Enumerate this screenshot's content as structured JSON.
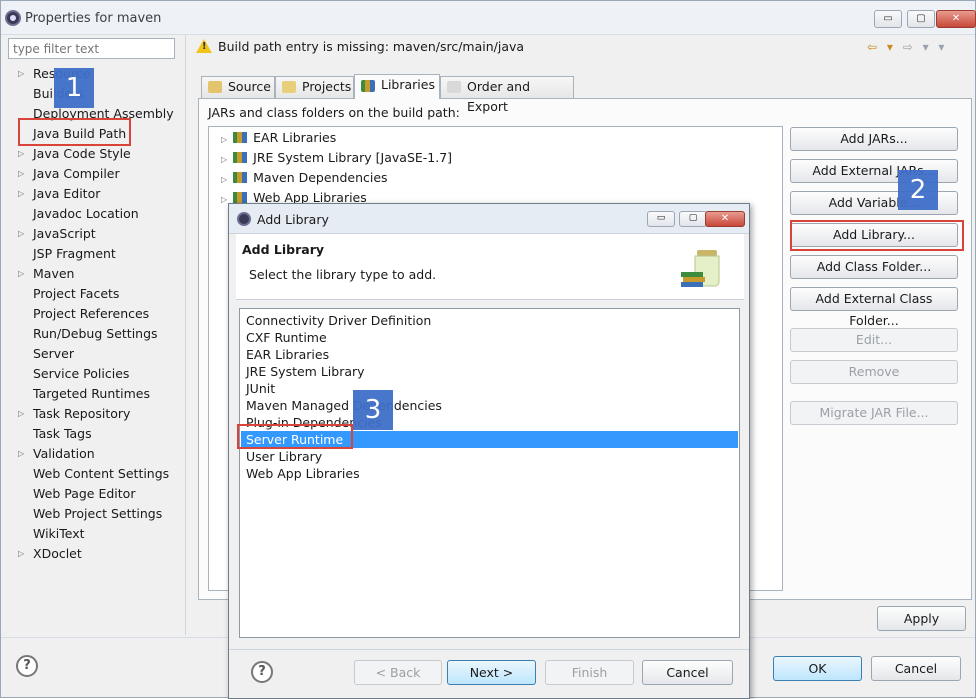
{
  "window": {
    "title": "Properties for maven",
    "controls": {
      "minimize": "▭",
      "maximize": "▢",
      "close": "✕"
    }
  },
  "filter": {
    "placeholder": "type filter text"
  },
  "tree": [
    {
      "label": "Resource",
      "expandable": true
    },
    {
      "label": "Builders",
      "expandable": false
    },
    {
      "label": "Deployment Assembly",
      "expandable": false
    },
    {
      "label": "Java Build Path",
      "expandable": false
    },
    {
      "label": "Java Code Style",
      "expandable": true
    },
    {
      "label": "Java Compiler",
      "expandable": true
    },
    {
      "label": "Java Editor",
      "expandable": true
    },
    {
      "label": "Javadoc Location",
      "expandable": false
    },
    {
      "label": "JavaScript",
      "expandable": true
    },
    {
      "label": "JSP Fragment",
      "expandable": false
    },
    {
      "label": "Maven",
      "expandable": true
    },
    {
      "label": "Project Facets",
      "expandable": false
    },
    {
      "label": "Project References",
      "expandable": false
    },
    {
      "label": "Run/Debug Settings",
      "expandable": false
    },
    {
      "label": "Server",
      "expandable": false
    },
    {
      "label": "Service Policies",
      "expandable": false
    },
    {
      "label": "Targeted Runtimes",
      "expandable": false
    },
    {
      "label": "Task Repository",
      "expandable": true
    },
    {
      "label": "Task Tags",
      "expandable": false
    },
    {
      "label": "Validation",
      "expandable": true
    },
    {
      "label": "Web Content Settings",
      "expandable": false
    },
    {
      "label": "Web Page Editor",
      "expandable": false
    },
    {
      "label": "Web Project Settings",
      "expandable": false
    },
    {
      "label": "WikiText",
      "expandable": false
    },
    {
      "label": "XDoclet",
      "expandable": true
    }
  ],
  "message": "Build path entry is missing: maven/src/main/java",
  "tabs": [
    {
      "label": "Source"
    },
    {
      "label": "Projects"
    },
    {
      "label": "Libraries"
    },
    {
      "label": "Order and Export"
    }
  ],
  "panel_label": "JARs and class folders on the build path:",
  "jars": [
    {
      "label": "EAR Libraries"
    },
    {
      "label": "JRE System Library [JavaSE-1.7]"
    },
    {
      "label": "Maven Dependencies"
    },
    {
      "label": "Web App Libraries"
    }
  ],
  "right_buttons": [
    {
      "label": "Add JARs...",
      "enabled": true
    },
    {
      "label": "Add External JARs...",
      "enabled": true
    },
    {
      "label": "Add Variable...",
      "enabled": true
    },
    {
      "label": "Add Library...",
      "enabled": true
    },
    {
      "label": "Add Class Folder...",
      "enabled": true
    },
    {
      "label": "Add External Class Folder...",
      "enabled": true
    },
    {
      "label": "Edit...",
      "enabled": false
    },
    {
      "label": "Remove",
      "enabled": false
    },
    {
      "label": "Migrate JAR File...",
      "enabled": false
    }
  ],
  "footer": {
    "apply": "Apply",
    "ok": "OK",
    "cancel": "Cancel",
    "help": "?"
  },
  "dialog": {
    "title": "Add Library",
    "heading": "Add Library",
    "subheading": "Select the library type to add.",
    "libraries": [
      "Connectivity Driver Definition",
      "CXF Runtime",
      "EAR Libraries",
      "JRE System Library",
      "JUnit",
      "Maven Managed Dependencies",
      "Plug-in Dependencies",
      "Server Runtime",
      "User Library",
      "Web App Libraries"
    ],
    "selected_index": 7,
    "buttons": {
      "back": "< Back",
      "next": "Next >",
      "finish": "Finish",
      "cancel": "Cancel",
      "help": "?"
    }
  },
  "annotations": [
    "1",
    "2",
    "3"
  ],
  "colors": {
    "selection": "#3399ff",
    "annotation_box": "#d9443a",
    "annotation_badge": "#3f6fc9"
  }
}
